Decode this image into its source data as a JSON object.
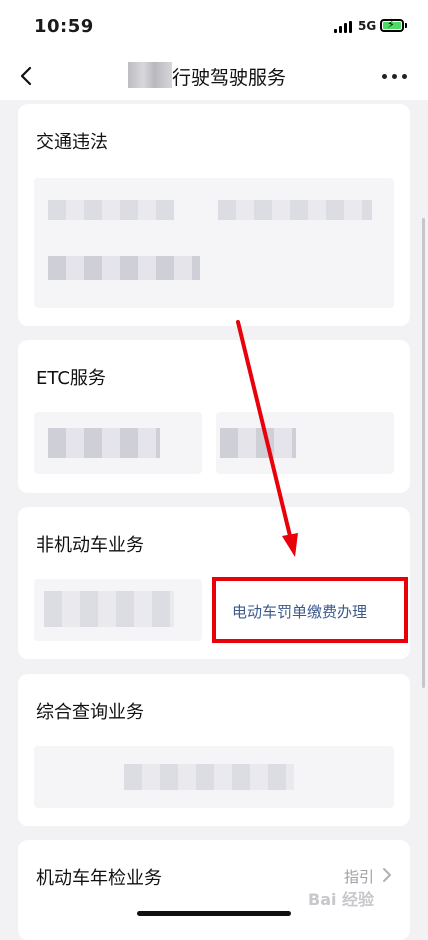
{
  "status_bar": {
    "time": "10:59",
    "network": "5G"
  },
  "nav": {
    "title": "行驶驾驶服务"
  },
  "sections": [
    {
      "title": "交通违法"
    },
    {
      "title": "ETC服务"
    },
    {
      "title": "非机动车业务",
      "link": "电动车罚单缴费办理"
    },
    {
      "title": "综合查询业务"
    },
    {
      "title": "机动车年检业务",
      "guide": "指引"
    }
  ],
  "watermark": "Bai 经验",
  "colors": {
    "annotation_red": "#e8000b",
    "link": "#3d5a8c"
  }
}
